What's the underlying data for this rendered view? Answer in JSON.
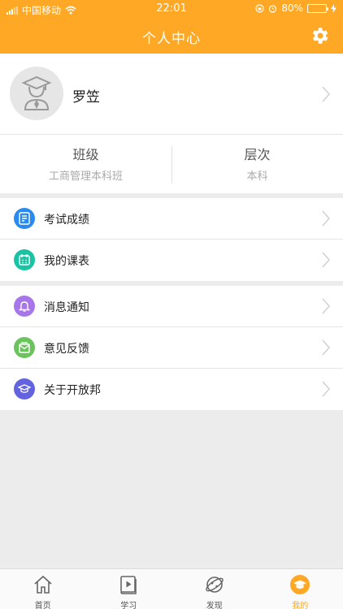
{
  "status_bar": {
    "carrier": "中国移动",
    "time": "22:01",
    "battery_percent": "80%",
    "battery_level": 0.8
  },
  "header": {
    "title": "个人中心",
    "settings_icon": "gear-icon"
  },
  "profile": {
    "name": "罗笠",
    "avatar_icon": "graduate-avatar-icon"
  },
  "stats": [
    {
      "label": "班级",
      "value": "工商管理本科班"
    },
    {
      "label": "层次",
      "value": "本科"
    }
  ],
  "menu_group_1": [
    {
      "label": "考试成绩",
      "icon": "exam-report-icon",
      "color": "#2b8af0"
    },
    {
      "label": "我的课表",
      "icon": "calendar-icon",
      "color": "#19c3a3"
    }
  ],
  "menu_group_2": [
    {
      "label": "消息通知",
      "icon": "bell-icon",
      "color": "#a776e8"
    },
    {
      "label": "意见反馈",
      "icon": "feedback-mail-icon",
      "color": "#6cc35d"
    },
    {
      "label": "关于开放邦",
      "icon": "graduation-cap-icon",
      "color": "#6363e0"
    }
  ],
  "tabbar": [
    {
      "label": "首页",
      "icon": "home-icon",
      "active": false
    },
    {
      "label": "学习",
      "icon": "video-book-icon",
      "active": false
    },
    {
      "label": "发现",
      "icon": "planet-icon",
      "active": false
    },
    {
      "label": "我的",
      "icon": "graduation-cap-icon",
      "active": true
    }
  ],
  "colors": {
    "brand": "#ffa826",
    "background": "#ececec"
  }
}
